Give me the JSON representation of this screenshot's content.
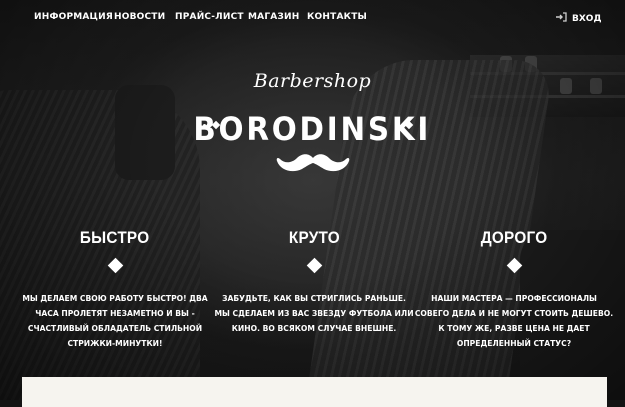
{
  "nav": {
    "items": [
      {
        "label": "ИНФОРМАЦИЯ"
      },
      {
        "label": "НОВОСТИ"
      },
      {
        "label": "ПРАЙС-ЛИСТ"
      },
      {
        "label": "МАГАЗИН"
      },
      {
        "label": "КОНТАКТЫ"
      }
    ],
    "login_label": "ВХОД",
    "login_icon": "sign-in-icon"
  },
  "logo": {
    "script": "Barbershop",
    "name": "BORODINSKI",
    "icon": "mustache-icon"
  },
  "features": [
    {
      "title": "БЫСТРО",
      "text": "МЫ ДЕЛАЕМ СВОЮ РАБОТУ БЫСТРО! ДВА ЧАСА ПРОЛЕТЯТ НЕЗАМЕТНО И ВЫ - СЧАСТЛИВЫЙ ОБЛАДАТЕЛЬ СТИЛЬНОЙ СТРИЖКИ-МИНУТКИ!"
    },
    {
      "title": "КРУТО",
      "text": "ЗАБУДЬТЕ, КАК ВЫ СТРИГЛИСЬ РАНЬШЕ. МЫ СДЕЛАЕМ ИЗ ВАС ЗВЕЗДУ ФУТБОЛА ИЛИ КИНО. ВО ВСЯКОМ СЛУЧАЕ ВНЕШНЕ."
    },
    {
      "title": "ДОРОГО",
      "text": "НАШИ МАСТЕРА — ПРОФЕССИОНАЛЫ СОВЕГО ДЕЛА И НЕ МОГУТ СТОИТЬ ДЕШЕВО. К ТОМУ ЖЕ, РАЗВЕ ЦЕНА НЕ ДАЕТ ОПРЕДЕЛЕННЫЙ СТАТУС?"
    }
  ],
  "colors": {
    "text": "#ffffff",
    "background": "#141414",
    "panel": "#f6f4ef"
  }
}
